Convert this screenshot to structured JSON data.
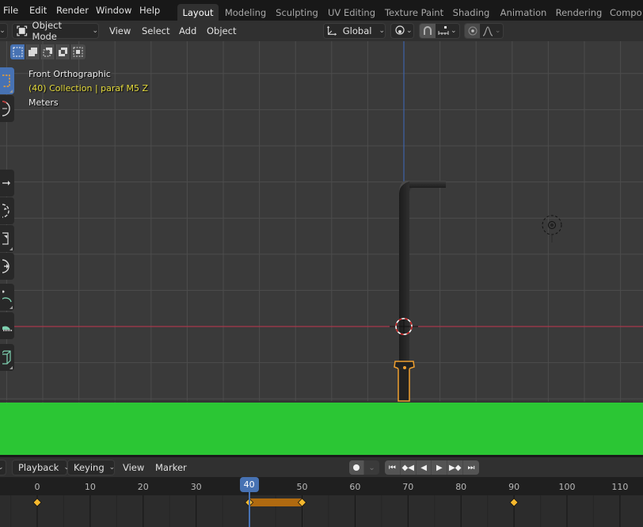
{
  "topbar": {
    "menus": [
      "File",
      "Edit",
      "Render",
      "Window",
      "Help"
    ],
    "workspaces": [
      "Layout",
      "Modeling",
      "Sculpting",
      "UV Editing",
      "Texture Paint",
      "Shading",
      "Animation",
      "Rendering",
      "Compo"
    ],
    "active_workspace": "Layout"
  },
  "viewport_header": {
    "mode": "Object Mode",
    "menus": [
      "View",
      "Select",
      "Add",
      "Object"
    ],
    "transform_orientation": "Global"
  },
  "viewport": {
    "view_name": "Front Orthographic",
    "collection_info": "(40) Collection | paraf M5 Z",
    "units": "Meters",
    "select_modes": [
      "select-new",
      "select-extend",
      "select-subtract",
      "select-difference",
      "select-intersect"
    ],
    "tools": [
      "select-box",
      "cursor",
      "move",
      "rotate",
      "scale",
      "transform",
      "annotate",
      "measure",
      "add-cube"
    ],
    "colors": {
      "background": "#3a3a3a",
      "x_axis": "#a8384a",
      "z_axis": "#3d63a8",
      "selection_outline": "#f0a030",
      "ground": "#2bc634",
      "active_tool": "#4772b3"
    }
  },
  "timeline": {
    "header_menus": [
      "Playback",
      "Keying",
      "View",
      "Marker"
    ],
    "playback_controls": [
      "jump-to-start",
      "jump-to-prev-keyframe",
      "play-reverse",
      "play",
      "jump-to-next-keyframe",
      "jump-to-end"
    ],
    "current_frame": "40",
    "ticks": [
      "0",
      "10",
      "20",
      "30",
      "40",
      "50",
      "60",
      "70",
      "80",
      "90",
      "100",
      "110"
    ],
    "keyframes": [
      0,
      40,
      50,
      90
    ],
    "hold_range": [
      40,
      50
    ],
    "colors": {
      "keyframe": "#f5b82e",
      "hold_bar": "#b06a10",
      "playhead": "#4772b3"
    }
  }
}
